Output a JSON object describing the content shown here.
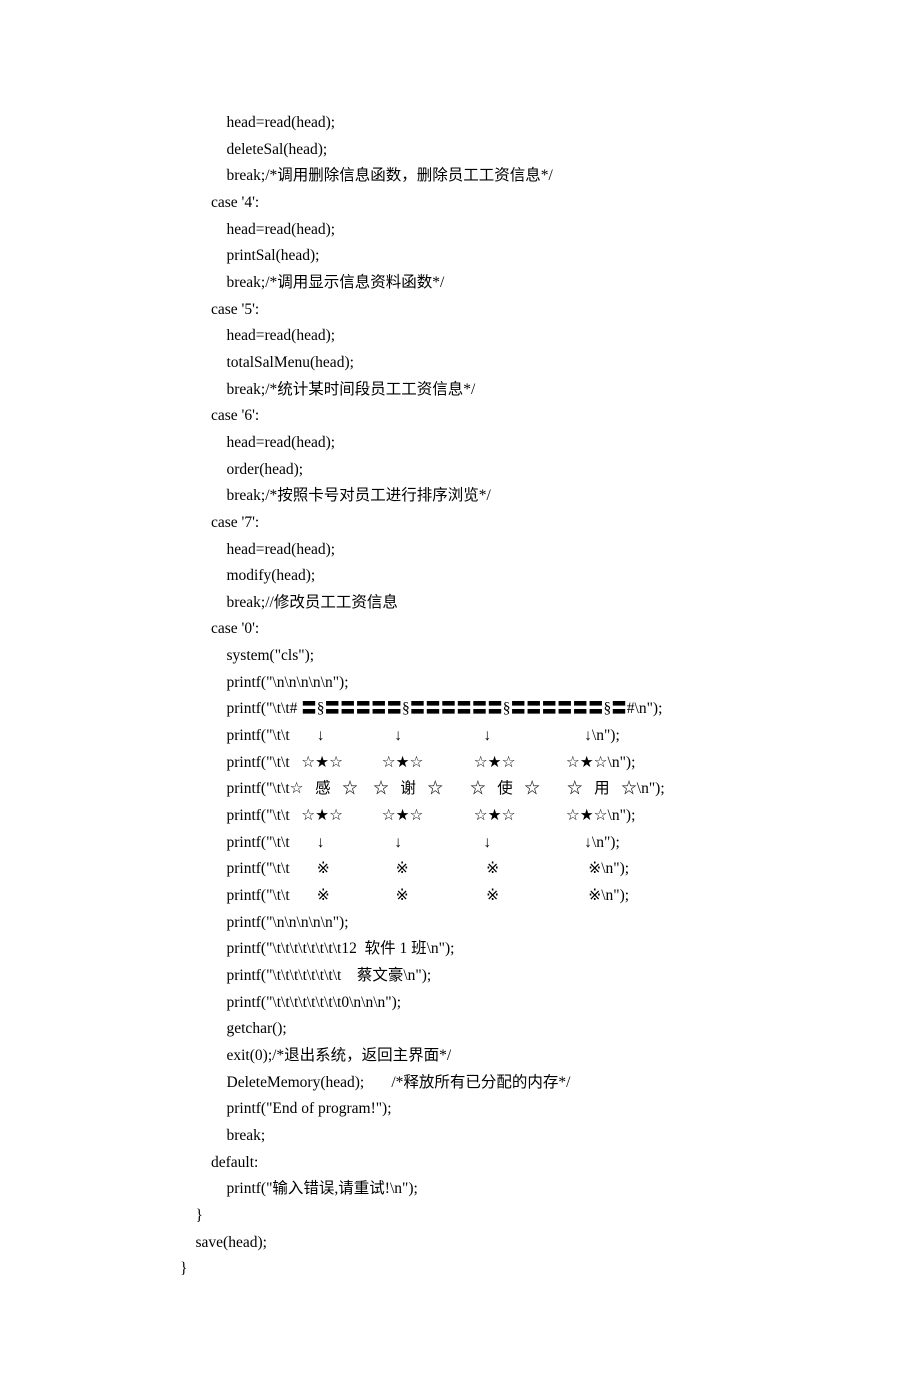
{
  "lines": [
    "            head=read(head);",
    "            deleteSal(head);",
    "            break;/*调用删除信息函数，删除员工工资信息*/",
    "        case '4':",
    "            head=read(head);",
    "            printSal(head);",
    "            break;/*调用显示信息资料函数*/",
    "        case '5':",
    "            head=read(head);",
    "            totalSalMenu(head);",
    "            break;/*统计某时间段员工工资信息*/",
    "        case '6':",
    "            head=read(head);",
    "            order(head);",
    "            break;/*按照卡号对员工进行排序浏览*/",
    "        case '7':",
    "            head=read(head);",
    "            modify(head);",
    "            break;//修改员工工资信息",
    "        case '0':",
    "            system(\"cls\");",
    "            printf(\"\\n\\n\\n\\n\\n\");",
    "            printf(\"\\t\\t# 〓§〓〓〓〓〓§〓〓〓〓〓〓§〓〓〓〓〓〓§〓#\\n\");",
    "            printf(\"\\t\\t       ↓                  ↓                     ↓                        ↓\\n\");",
    "            printf(\"\\t\\t   ☆★☆          ☆★☆             ☆★☆             ☆★☆\\n\");",
    "            printf(\"\\t\\t☆   感   ☆    ☆   谢   ☆       ☆   使   ☆       ☆   用   ☆\\n\");",
    "            printf(\"\\t\\t   ☆★☆          ☆★☆             ☆★☆             ☆★☆\\n\");",
    "            printf(\"\\t\\t       ↓                  ↓                     ↓                        ↓\\n\");",
    "            printf(\"\\t\\t       ※                 ※                    ※                       ※\\n\");",
    "            printf(\"\\t\\t       ※                 ※                    ※                       ※\\n\");",
    "            printf(\"\\n\\n\\n\\n\\n\");",
    "            printf(\"\\t\\t\\t\\t\\t\\t\\t\\t12  软件 1 班\\n\");",
    "            printf(\"\\t\\t\\t\\t\\t\\t\\t\\t    蔡文豪\\n\");",
    "            printf(\"\\t\\t\\t\\t\\t\\t\\t\\t0\\n\\n\\n\");",
    "            getchar();",
    "            exit(0);/*退出系统，返回主界面*/",
    "            DeleteMemory(head);       /*释放所有已分配的内存*/",
    "            printf(\"End of program!\");",
    "            break;",
    "        default:",
    "            printf(\"输入错误,请重试!\\n\");",
    "    }",
    "    save(head);",
    "}"
  ]
}
